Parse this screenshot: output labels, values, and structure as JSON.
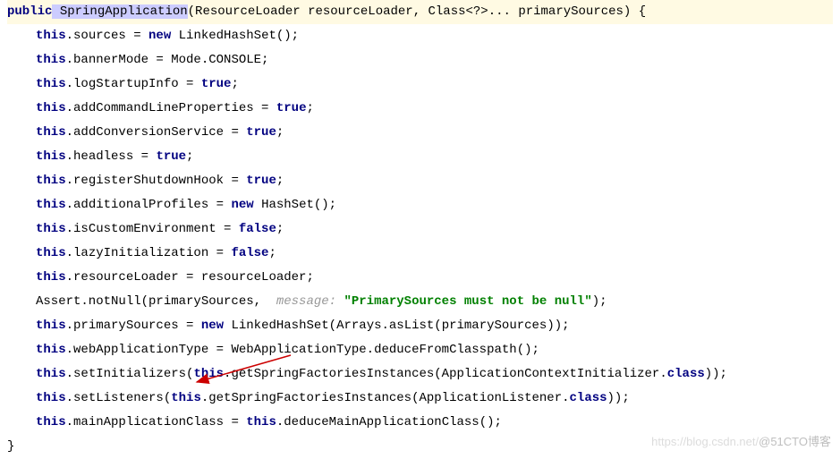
{
  "code": {
    "sig_public": "public",
    "sig_name": " SpringApplication",
    "sig_params": "(ResourceLoader resourceLoader, Class<?>... primarySources) {",
    "l1_this": "this",
    "l1_a": ".sources = ",
    "l1_new": "new",
    "l1_b": " LinkedHashSet();",
    "l2_this": "this",
    "l2_a": ".bannerMode = Mode.CONSOLE;",
    "l3_this": "this",
    "l3_a": ".logStartupInfo = ",
    "l3_true": "true",
    "l3_b": ";",
    "l4_this": "this",
    "l4_a": ".addCommandLineProperties = ",
    "l4_true": "true",
    "l4_b": ";",
    "l5_this": "this",
    "l5_a": ".addConversionService = ",
    "l5_true": "true",
    "l5_b": ";",
    "l6_this": "this",
    "l6_a": ".headless = ",
    "l6_true": "true",
    "l6_b": ";",
    "l7_this": "this",
    "l7_a": ".registerShutdownHook = ",
    "l7_true": "true",
    "l7_b": ";",
    "l8_this": "this",
    "l8_a": ".additionalProfiles = ",
    "l8_new": "new",
    "l8_b": " HashSet();",
    "l9_this": "this",
    "l9_a": ".isCustomEnvironment = ",
    "l9_false": "false",
    "l9_b": ";",
    "l10_this": "this",
    "l10_a": ".lazyInitialization = ",
    "l10_false": "false",
    "l10_b": ";",
    "l11_this": "this",
    "l11_a": ".resourceLoader = resourceLoader;",
    "l12_a": "Assert.notNull(primarySources, ",
    "l12_hint": " message: ",
    "l12_str": "\"PrimarySources must not be null\"",
    "l12_b": ");",
    "l13_this": "this",
    "l13_a": ".primarySources = ",
    "l13_new": "new",
    "l13_b": " LinkedHashSet(Arrays.asList(primarySources));",
    "l14_this": "this",
    "l14_a": ".webApplicationType = WebApplicationType.deduceFromClasspath();",
    "l15_this": "this",
    "l15_a": ".setInitializers(",
    "l15_this2": "this",
    "l15_b": ".getSpringFactoriesInstances(ApplicationContextInitializer.",
    "l15_class": "class",
    "l15_c": "));",
    "l16_this": "this",
    "l16_a": ".setListeners(",
    "l16_this2": "this",
    "l16_b": ".getSpringFactoriesInstances(ApplicationListener.",
    "l16_class": "class",
    "l16_c": "));",
    "l17_this": "this",
    "l17_a": ".mainApplicationClass = ",
    "l17_this2": "this",
    "l17_b": ".deduceMainApplicationClass();",
    "close": "}"
  },
  "watermark": {
    "left": "https://blog.csdn.net/",
    "right": "@51CTO博客"
  }
}
